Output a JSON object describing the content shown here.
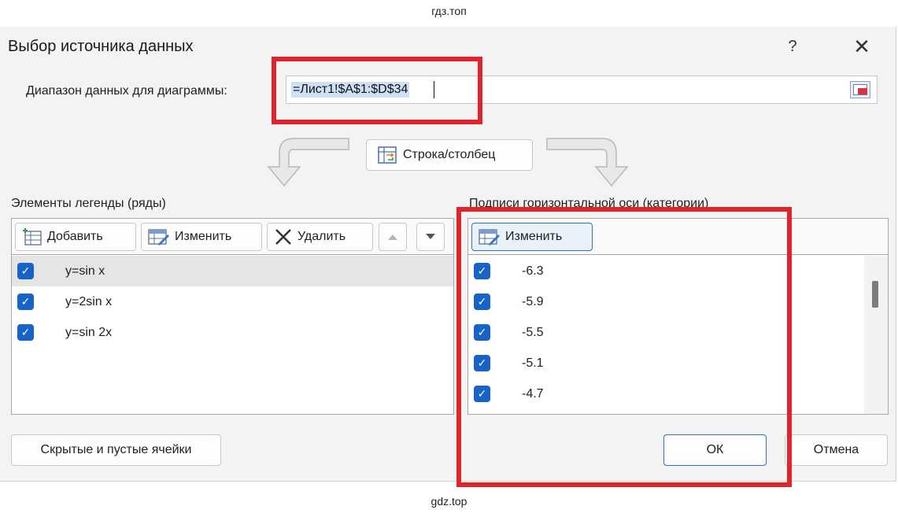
{
  "watermark_top": "гдз.топ",
  "watermark_bottom": "gdz.top",
  "dialog": {
    "title": "Выбор источника данных",
    "help_label": "?",
    "close_label": "✕"
  },
  "range": {
    "label": "Диапазон данных для диаграммы:",
    "value": "=Лист1!$A$1:$D$34"
  },
  "switch_button_label": "Строка/столбец",
  "legend": {
    "heading": "Элементы легенды (ряды)",
    "add_label": "Добавить",
    "edit_label": "Изменить",
    "delete_label": "Удалить",
    "items": [
      {
        "label": "y=sin x",
        "checked": true,
        "selected": true
      },
      {
        "label": "y=2sin x",
        "checked": true,
        "selected": false
      },
      {
        "label": "y=sin 2x",
        "checked": true,
        "selected": false
      }
    ]
  },
  "axis": {
    "heading": "Подписи горизонтальной оси (категории)",
    "edit_label": "Изменить",
    "items": [
      {
        "label": "-6.3",
        "checked": true
      },
      {
        "label": "-5.9",
        "checked": true
      },
      {
        "label": "-5.5",
        "checked": true
      },
      {
        "label": "-5.1",
        "checked": true
      },
      {
        "label": "-4.7",
        "checked": true
      }
    ]
  },
  "footer": {
    "hidden_cells_label": "Скрытые и пустые ячейки",
    "ok_label": "ОК",
    "cancel_label": "Отмена"
  },
  "colors": {
    "accent": "#2a73c9",
    "checkbox": "#1763c7",
    "highlight": "#e0242e"
  }
}
